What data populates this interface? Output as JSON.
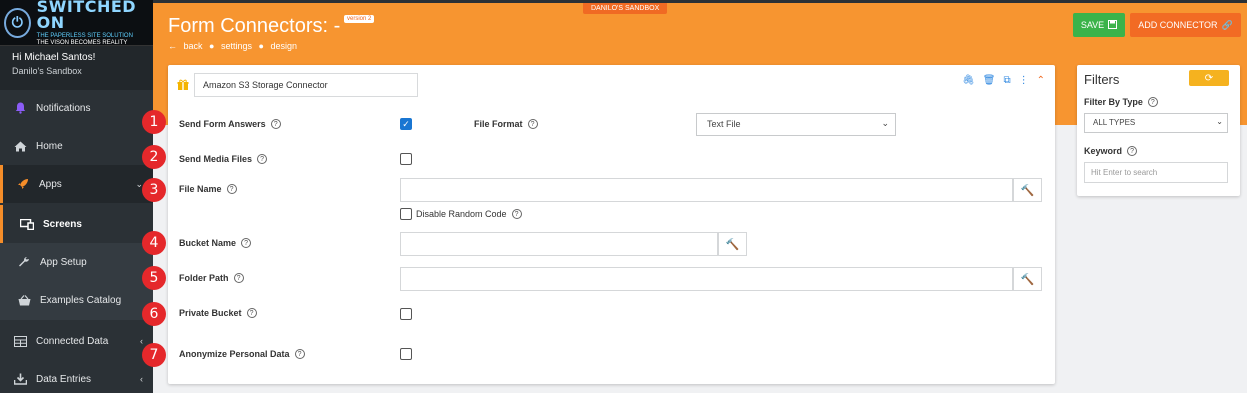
{
  "sidebar": {
    "logo": {
      "title": "SWITCHED ON",
      "sub1": "THE PAPERLESS SITE SOLUTION",
      "sub2": "THE VISON BECOMES REALITY"
    },
    "user": {
      "greeting": "Hi Michael Santos!",
      "sandbox": "Danilo's Sandbox"
    },
    "items": [
      {
        "label": "Notifications",
        "icon": "bell-icon"
      },
      {
        "label": "Home",
        "icon": "home-icon"
      },
      {
        "label": "Apps",
        "icon": "rocket-icon"
      },
      {
        "label": "Screens",
        "icon": "screens-icon"
      },
      {
        "label": "App Setup",
        "icon": "wrench-icon"
      },
      {
        "label": "Examples Catalog",
        "icon": "basket-icon"
      },
      {
        "label": "Connected Data",
        "icon": "table-icon"
      },
      {
        "label": "Data Entries",
        "icon": "download-icon"
      }
    ]
  },
  "header": {
    "sandbox_tag": "DANILO'S SANDBOX",
    "title": "Form Connectors: -",
    "version": "version 2",
    "breadcrumbs": [
      "back",
      "settings",
      "design"
    ],
    "save_label": "SAVE",
    "add_label": "ADD CONNECTOR"
  },
  "card": {
    "connector_name": "Amazon S3 Storage Connector",
    "fields": {
      "send_form_answers": "Send Form Answers",
      "file_format_label": "File Format",
      "file_format_value": "Text File",
      "send_media_files": "Send Media Files",
      "file_name": "File Name",
      "disable_random_code": "Disable Random Code",
      "bucket_name": "Bucket Name",
      "folder_path": "Folder Path",
      "private_bucket": "Private Bucket",
      "anonymize": "Anonymize Personal Data"
    },
    "badges": [
      "1",
      "2",
      "3",
      "4",
      "5",
      "6",
      "7"
    ]
  },
  "filters": {
    "title": "Filters",
    "filter_by_type_label": "Filter By Type",
    "filter_by_type_value": "ALL TYPES",
    "keyword_label": "Keyword",
    "keyword_placeholder": "Hit Enter to search"
  }
}
